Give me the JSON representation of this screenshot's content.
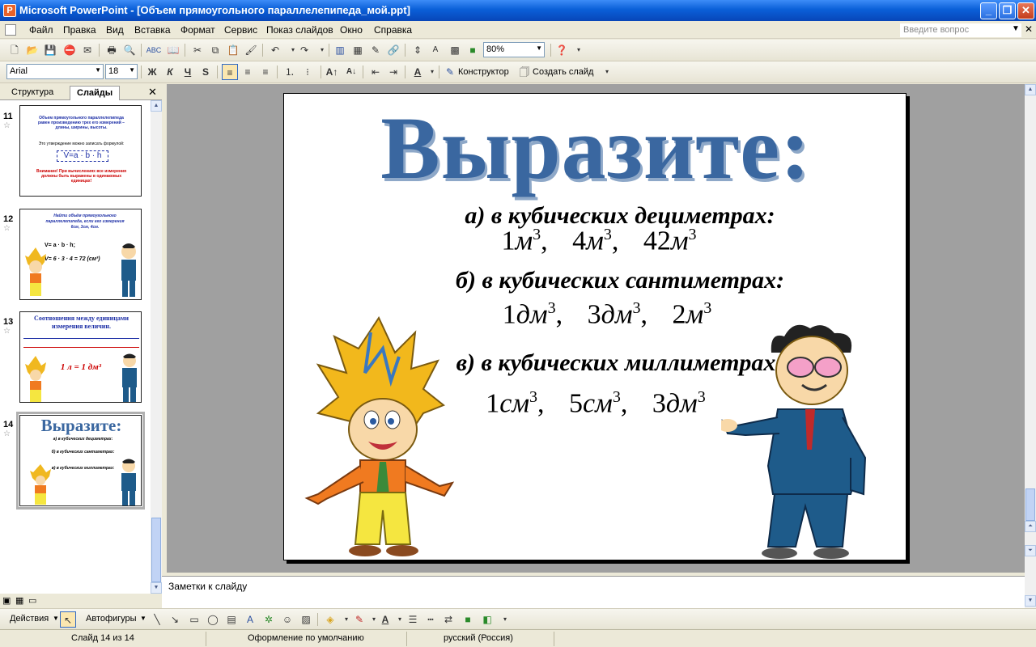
{
  "window": {
    "title": "Microsoft PowerPoint - [Объем прямоугольного параллелепипеда_мой.ppt]",
    "app_icon": "powerpoint-icon"
  },
  "menu": {
    "items": [
      "Файл",
      "Правка",
      "Вид",
      "Вставка",
      "Формат",
      "Сервис",
      "Показ слайдов",
      "Окно",
      "Справка"
    ],
    "help_placeholder": "Введите вопрос"
  },
  "toolbar": {
    "zoom": "80%",
    "font": "Arial",
    "font_size": "18",
    "bold": "Ж",
    "italic": "К",
    "underline": "Ч",
    "shadow": "S",
    "designer": "Конструктор",
    "new_slide": "Создать слайд"
  },
  "panel": {
    "tabs": [
      "Структура",
      "Слайды"
    ],
    "thumbnails": [
      {
        "num": "11",
        "lines": [
          "Объем прямоугольного параллелепипеда",
          "равен произведению трех его измерений –",
          "длины, ширины, высоты.",
          "Это утверждение можно записать формулой:"
        ],
        "formula": "V=a · b · h",
        "warning": [
          "Внимание! При вычислениях все измерения",
          "должны быть выражены в одинаковых",
          "единицах!"
        ]
      },
      {
        "num": "12",
        "lines": [
          "Найти объём прямоугольного",
          "параллелепипеда, если его измерения",
          "6см, 3см, 4см."
        ],
        "formula": "V= a · b · h;",
        "formula2": "V= 6 · 3 · 4 = 72 (см³)"
      },
      {
        "num": "13",
        "lines": [
          "Соотношения между единицами",
          "измерения величин."
        ],
        "formula": "1 л = 1 дм³"
      },
      {
        "num": "14",
        "title": "Выразите:",
        "lines": [
          "а) в кубических дециметрах:",
          "б) в кубических сантиметрах:",
          "в) в кубических миллиметрах:"
        ]
      }
    ]
  },
  "slide": {
    "title": "Выразите:",
    "sections": [
      {
        "heading": "а) в кубических дециметрах:",
        "values": [
          {
            "n": "1",
            "u": "м"
          },
          {
            "n": "4",
            "u": "м"
          },
          {
            "n": "42",
            "u": "м"
          }
        ]
      },
      {
        "heading": "б) в кубических сантиметрах:",
        "values": [
          {
            "n": "1",
            "u": "дм"
          },
          {
            "n": "3",
            "u": "дм"
          },
          {
            "n": "2",
            "u": "м"
          }
        ]
      },
      {
        "heading": "в) в кубических миллиметрах:",
        "values": [
          {
            "n": "1",
            "u": "см"
          },
          {
            "n": "5",
            "u": "см"
          },
          {
            "n": "3",
            "u": "дм"
          }
        ]
      }
    ],
    "exp": "3"
  },
  "notes": {
    "placeholder": "Заметки к слайду"
  },
  "drawing": {
    "actions": "Действия",
    "autoshapes": "Автофигуры"
  },
  "status": {
    "slide": "Слайд 14 из 14",
    "design": "Оформление по умолчанию",
    "language": "русский (Россия)"
  }
}
